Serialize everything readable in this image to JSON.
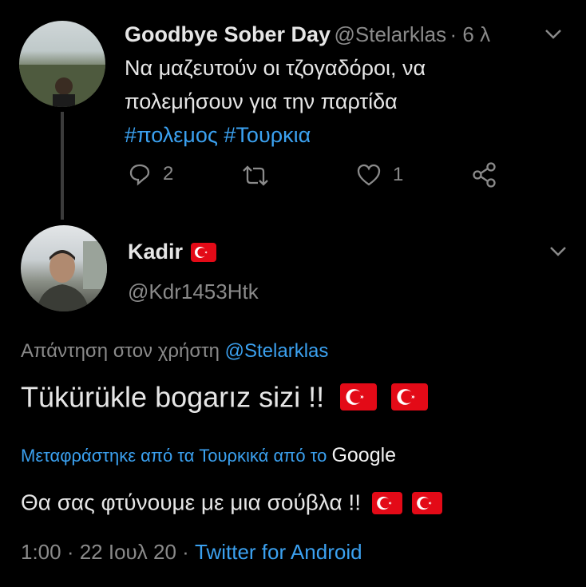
{
  "tweet1": {
    "name": "Goodbye Sober Day",
    "handle": "@Stelarklas",
    "time": "· 6 λ",
    "text_line1": "Να μαζευτούν οι τζογαδόροι, να",
    "text_line2": "πολεμήσουν για την παρτίδα",
    "hashtags": "#πολεμος #Τουρκια",
    "reply_count": "2",
    "like_count": "1"
  },
  "tweet2": {
    "name": "Kadir",
    "handle": "@Kdr1453Htk",
    "reply_prefix": "Απάντηση στον χρήστη",
    "reply_to": "@Stelarklas",
    "text": "Tükürükle bogarız sizi !!",
    "translated_label": "Μεταφράστηκε από τα Τουρκικά από το",
    "translator": "Google",
    "translation": "Θα σας φτύνουμε με μια σούβλα !!",
    "time": "1:00 · 22 Ιουλ 20 ·",
    "source": "Twitter for Android"
  },
  "colors": {
    "background": "#000000",
    "link": "#3ba1f0",
    "muted": "#8a8a8a",
    "flag_red": "#e30a17"
  }
}
